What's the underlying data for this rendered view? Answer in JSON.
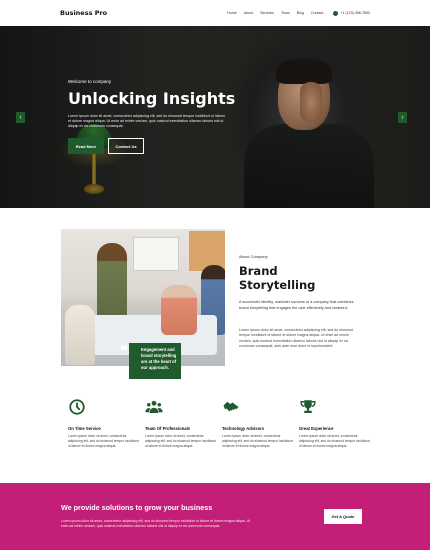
{
  "header": {
    "logo": "Business Pro",
    "nav": [
      "Home",
      "About",
      "Services",
      "Team",
      "Blog",
      "Contact"
    ],
    "phone": "+1 (123) 456-7890"
  },
  "hero": {
    "eyebrow": "Welcome to company",
    "title": "Unlocking Insights",
    "text": "Lorem ipsum dolor sit amet, consectetur adipiscing elit, sed do eiusmod tempor incididunt ut labore et dolore magna aliqua. Ut enim ad minim veniam, quis nostrud exercitation ullamco laboris nisi ut aliquip ex ea commodo consequat.",
    "primary_button": "Read More",
    "secondary_button": "Contact Us",
    "prev_arrow": "‹",
    "next_arrow": "›",
    "accent_color": "#1f5b2d"
  },
  "about": {
    "eyebrow": "About Company",
    "title": "Brand Storytelling",
    "paragraph1": "A successful identity, marketer success or a company that combines brand storytelling that engages the user effectively and creates it.",
    "paragraph2": "Lorem ipsum dolor sit amet, consectetur adipiscing elit, sed do eiusmod tempor incididunt ut labore et dolore magna aliqua. Ut enim ad minim veniam, quis nostrud exercitation ullamco laboris nisi ut aliquip ex ea commodo consequat, duis aute irure dolor in reprehenderit.",
    "quote": "Engagement and brand storytelling are at the heart of our approach.",
    "quote_mark": "❝"
  },
  "features": [
    {
      "icon": "clock-icon",
      "title": "On Time Service",
      "text": "Lorem ipsum dolor sit amet, consectetur adipiscing elit, sed do eiusmod tempor incididunt ut labore et dolore magna aliqua."
    },
    {
      "icon": "team-icon",
      "title": "Team Of Professionals",
      "text": "Lorem ipsum dolor sit amet, consectetur adipiscing elit, sed do eiusmod tempor incididunt ut labore et dolore magna aliqua."
    },
    {
      "icon": "handshake-icon",
      "title": "Technology Advisors",
      "text": "Lorem ipsum dolor sit amet, consectetur adipiscing elit, sed do eiusmod tempor incididunt ut labore et dolore magna aliqua."
    },
    {
      "icon": "trophy-icon",
      "title": "Great Experience",
      "text": "Lorem ipsum dolor sit amet, consectetur adipiscing elit, sed do eiusmod tempor incididunt ut labore et dolore magna aliqua."
    }
  ],
  "cta": {
    "title": "We provide solutions to grow your business",
    "text": "Lorem ipsum dolor sit amet, consectetur adipiscing elit, sed do eiusmod tempor incididunt ut labore et dolore magna aliqua. Ut enim ad minim veniam, quis nostrud exercitation ullamco laboris nisi ut aliquip ex ea commodo consequat.",
    "button": "Get A Quote",
    "background_color": "#c41f78"
  }
}
